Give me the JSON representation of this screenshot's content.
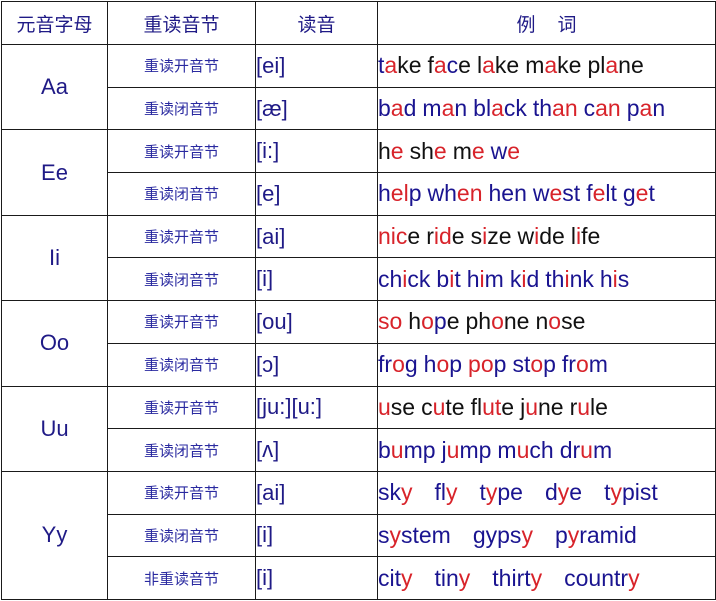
{
  "colors": {
    "blue": "#1a1490",
    "red": "#d8232a",
    "black": "#111111",
    "header_text": "#1f1a86"
  },
  "headers": {
    "vowel_letter": "元音字母",
    "stressed_syllable": "重读音节",
    "pronunciation": "读音",
    "example_part1": "例",
    "example_part2": "词"
  },
  "rows": [
    {
      "letter": "Aa",
      "entries": [
        {
          "syllable": "重读开音节",
          "phonetic": "[ei]",
          "words": [
            [
              [
                "t",
                "b"
              ],
              [
                "a",
                "r"
              ],
              [
                "ke",
                "k"
              ]
            ],
            [
              [
                "f",
                "k"
              ],
              [
                "a",
                "r"
              ],
              [
                "c",
                "b"
              ],
              [
                "e",
                "k"
              ]
            ],
            [
              [
                "l",
                "k"
              ],
              [
                "a",
                "r"
              ],
              [
                "ke",
                "k"
              ]
            ],
            [
              [
                "m",
                "k"
              ],
              [
                "a",
                "r"
              ],
              [
                "ke",
                "k"
              ]
            ],
            [
              [
                "pl",
                "k"
              ],
              [
                "a",
                "r"
              ],
              [
                "ne",
                "k"
              ]
            ]
          ]
        },
        {
          "syllable": "重读闭音节",
          "phonetic": "[æ]",
          "words": [
            [
              [
                "b",
                "b"
              ],
              [
                "a",
                "r"
              ],
              [
                "d",
                "b"
              ]
            ],
            [
              [
                "m",
                "b"
              ],
              [
                "a",
                "r"
              ],
              [
                "n",
                "b"
              ]
            ],
            [
              [
                "bl",
                "b"
              ],
              [
                "a",
                "r"
              ],
              [
                "ck",
                "b"
              ]
            ],
            [
              [
                "th",
                "b"
              ],
              [
                "an",
                "r"
              ]
            ],
            [
              [
                "c",
                "b"
              ],
              [
                "an",
                "r"
              ]
            ],
            [
              [
                "p",
                "b"
              ],
              [
                "a",
                "r"
              ],
              [
                "n",
                "b"
              ]
            ]
          ]
        }
      ]
    },
    {
      "letter": "Ee",
      "entries": [
        {
          "syllable": "重读开音节",
          "phonetic": "[i:]",
          "words": [
            [
              [
                "h",
                "k"
              ],
              [
                "e",
                "r"
              ]
            ],
            [
              [
                "sh",
                "k"
              ],
              [
                "e",
                "r"
              ]
            ],
            [
              [
                "m",
                "k"
              ],
              [
                "e",
                "r"
              ]
            ],
            [
              [
                "w",
                "b"
              ],
              [
                "e",
                "r"
              ]
            ]
          ]
        },
        {
          "syllable": "重读闭音节",
          "phonetic": "[e]",
          "words": [
            [
              [
                "h",
                "b"
              ],
              [
                "el",
                "r"
              ],
              [
                "p",
                "b"
              ]
            ],
            [
              [
                "wh",
                "b"
              ],
              [
                "en",
                "r"
              ]
            ],
            [
              [
                "hen",
                "b"
              ]
            ],
            [
              [
                "w",
                "b"
              ],
              [
                "e",
                "r"
              ],
              [
                "st",
                "b"
              ]
            ],
            [
              [
                "f",
                "b"
              ],
              [
                "e",
                "r"
              ],
              [
                "lt",
                "b"
              ]
            ],
            [
              [
                "g",
                "b"
              ],
              [
                "e",
                "r"
              ],
              [
                "t",
                "b"
              ]
            ]
          ]
        }
      ]
    },
    {
      "letter": "Ii",
      "entries": [
        {
          "syllable": "重读开音节",
          "phonetic": "[ai]",
          "words": [
            [
              [
                "nic",
                "r"
              ],
              [
                "e",
                "k"
              ]
            ],
            [
              [
                "r",
                "k"
              ],
              [
                "id",
                "r"
              ],
              [
                "e",
                "k"
              ]
            ],
            [
              [
                "s",
                "k"
              ],
              [
                "i",
                "r"
              ],
              [
                "ze",
                "k"
              ]
            ],
            [
              [
                "w",
                "k"
              ],
              [
                "i",
                "r"
              ],
              [
                "de",
                "k"
              ]
            ],
            [
              [
                "l",
                "k"
              ],
              [
                "i",
                "r"
              ],
              [
                "fe",
                "k"
              ]
            ]
          ]
        },
        {
          "syllable": "重读闭音节",
          "phonetic": "[i]",
          "words": [
            [
              [
                "ch",
                "b"
              ],
              [
                "i",
                "r"
              ],
              [
                "ck",
                "b"
              ]
            ],
            [
              [
                "b",
                "b"
              ],
              [
                "i",
                "r"
              ],
              [
                "t",
                "b"
              ]
            ],
            [
              [
                "h",
                "b"
              ],
              [
                "i",
                "r"
              ],
              [
                "m",
                "b"
              ]
            ],
            [
              [
                "k",
                "b"
              ],
              [
                "i",
                "r"
              ],
              [
                "d",
                "b"
              ]
            ],
            [
              [
                "th",
                "b"
              ],
              [
                "i",
                "r"
              ],
              [
                "nk",
                "b"
              ]
            ],
            [
              [
                "h",
                "b"
              ],
              [
                "i",
                "r"
              ],
              [
                "s",
                "b"
              ]
            ]
          ]
        }
      ]
    },
    {
      "letter": "Oo",
      "entries": [
        {
          "syllable": "重读开音节",
          "phonetic": "[ou]",
          "words": [
            [
              [
                "so",
                "r"
              ]
            ],
            [
              [
                "h",
                "k"
              ],
              [
                "o",
                "r"
              ],
              [
                "p",
                "b"
              ],
              [
                "e",
                "k"
              ]
            ],
            [
              [
                "ph",
                "k"
              ],
              [
                "o",
                "r"
              ],
              [
                "ne",
                "k"
              ]
            ],
            [
              [
                "n",
                "k"
              ],
              [
                "o",
                "r"
              ],
              [
                "se",
                "k"
              ]
            ]
          ]
        },
        {
          "syllable": "重读闭音节",
          "phonetic": "[ɔ]",
          "words": [
            [
              [
                "fr",
                "b"
              ],
              [
                "o",
                "r"
              ],
              [
                "g",
                "b"
              ]
            ],
            [
              [
                "h",
                "b"
              ],
              [
                "o",
                "r"
              ],
              [
                "p",
                "b"
              ]
            ],
            [
              [
                "po",
                "r"
              ],
              [
                "p",
                "b"
              ]
            ],
            [
              [
                "st",
                "b"
              ],
              [
                "o",
                "r"
              ],
              [
                "p",
                "b"
              ]
            ],
            [
              [
                "fr",
                "b"
              ],
              [
                "o",
                "r"
              ],
              [
                "m",
                "b"
              ]
            ]
          ]
        }
      ]
    },
    {
      "letter": "Uu",
      "entries": [
        {
          "syllable": "重读开音节",
          "phonetic": "[ju:][u:]",
          "words": [
            [
              [
                "u",
                "r"
              ],
              [
                "se",
                "k"
              ]
            ],
            [
              [
                "c",
                "k"
              ],
              [
                "u",
                "r"
              ],
              [
                "te",
                "k"
              ]
            ],
            [
              [
                "fl",
                "k"
              ],
              [
                "ut",
                "r"
              ],
              [
                "e",
                "k"
              ]
            ],
            [
              [
                "j",
                "k"
              ],
              [
                "u",
                "r"
              ],
              [
                "ne",
                "k"
              ]
            ],
            [
              [
                "r",
                "k"
              ],
              [
                "u",
                "r"
              ],
              [
                "le",
                "k"
              ]
            ]
          ]
        },
        {
          "syllable": "重读闭音节",
          "phonetic": "[ʌ]",
          "words": [
            [
              [
                "b",
                "b"
              ],
              [
                "u",
                "r"
              ],
              [
                "mp",
                "b"
              ]
            ],
            [
              [
                "j",
                "b"
              ],
              [
                "u",
                "r"
              ],
              [
                "mp",
                "b"
              ]
            ],
            [
              [
                "m",
                "b"
              ],
              [
                "u",
                "r"
              ],
              [
                "ch",
                "b"
              ]
            ],
            [
              [
                "dr",
                "b"
              ],
              [
                "u",
                "r"
              ],
              [
                "m",
                "b"
              ]
            ]
          ]
        }
      ]
    },
    {
      "letter": "Yy",
      "wide_gaps": true,
      "entries": [
        {
          "syllable": "重读开音节",
          "phonetic": "[ai]",
          "words": [
            [
              [
                "sk",
                "b"
              ],
              [
                "y",
                "r"
              ]
            ],
            [
              [
                "fl",
                "b"
              ],
              [
                "y",
                "r"
              ]
            ],
            [
              [
                "t",
                "b"
              ],
              [
                "y",
                "r"
              ],
              [
                "pe",
                "b"
              ]
            ],
            [
              [
                "d",
                "b"
              ],
              [
                "y",
                "r"
              ],
              [
                "e",
                "b"
              ]
            ],
            [
              [
                "t",
                "b"
              ],
              [
                "y",
                "r"
              ],
              [
                "pist",
                "b"
              ]
            ]
          ]
        },
        {
          "syllable": "重读闭音节",
          "phonetic": "[i]",
          "words": [
            [
              [
                "s",
                "b"
              ],
              [
                "y",
                "r"
              ],
              [
                "stem",
                "b"
              ]
            ],
            [
              [
                "gyps",
                "b"
              ],
              [
                "y",
                "r"
              ]
            ],
            [
              [
                "p",
                "b"
              ],
              [
                "y",
                "r"
              ],
              [
                "ramid",
                "b"
              ]
            ]
          ]
        },
        {
          "syllable": "非重读音节",
          "phonetic": "[i]",
          "words": [
            [
              [
                "cit",
                "b"
              ],
              [
                "y",
                "r"
              ]
            ],
            [
              [
                "tin",
                "b"
              ],
              [
                "y",
                "r"
              ]
            ],
            [
              [
                "thirt",
                "b"
              ],
              [
                "y",
                "r"
              ]
            ],
            [
              [
                "countr",
                "b"
              ],
              [
                "y",
                "r"
              ]
            ]
          ]
        }
      ]
    }
  ]
}
